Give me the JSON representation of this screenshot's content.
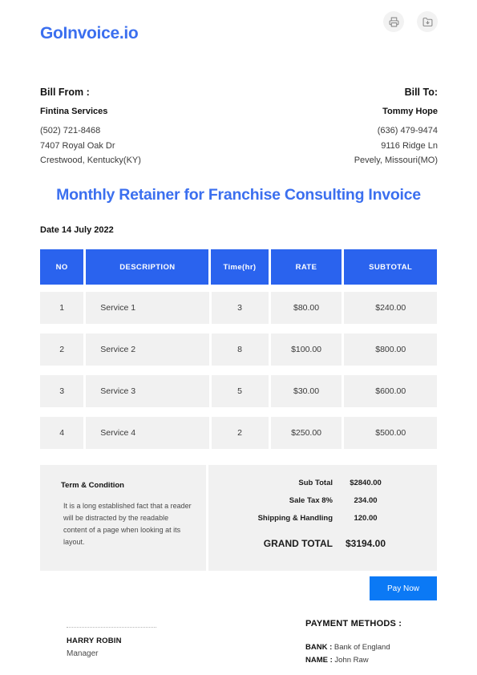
{
  "brand": {
    "logo_text": "GoInvoice.io",
    "accent_blue": "#3B6FEF",
    "table_header_blue": "#2A63EE",
    "pay_button_blue": "#0B79F5",
    "row_gray": "#f1f1f1"
  },
  "toolbar": {
    "print_icon": "printer-icon",
    "download_icon": "download-folder-icon"
  },
  "bill_from": {
    "heading": "Bill From :",
    "name": "Fintina Services",
    "phone": "(502) 721-8468",
    "address_line1": "7407 Royal Oak Dr",
    "address_line2": "Crestwood, Kentucky(KY)"
  },
  "bill_to": {
    "heading": "Bill To:",
    "name": "Tommy Hope",
    "phone": "(636) 479-9474",
    "address_line1": "9116 Ridge Ln",
    "address_line2": "Pevely, Missouri(MO)"
  },
  "invoice": {
    "title": "Monthly Retainer for Franchise Consulting Invoice",
    "date": "Date 14 July 2022"
  },
  "table": {
    "headers": {
      "no": "NO",
      "description": "DESCRIPTION",
      "time": "Time(hr)",
      "rate": "RATE",
      "subtotal": "SUBTOTAL"
    },
    "rows": [
      {
        "no": "1",
        "description": "Service 1",
        "time": "3",
        "rate": "$80.00",
        "subtotal": "$240.00"
      },
      {
        "no": "2",
        "description": "Service 2",
        "time": "8",
        "rate": "$100.00",
        "subtotal": "$800.00"
      },
      {
        "no": "3",
        "description": "Service 3",
        "time": "5",
        "rate": "$30.00",
        "subtotal": "$600.00"
      },
      {
        "no": "4",
        "description": "Service 4",
        "time": "2",
        "rate": "$250.00",
        "subtotal": "$500.00"
      }
    ]
  },
  "terms": {
    "title": "Term & Condition",
    "body": "It is a long established fact that a reader will be distracted by the readable content of a page when looking at its layout."
  },
  "totals": {
    "sub_total_label": "Sub Total",
    "sub_total_value": "$2840.00",
    "tax_label": "Sale Tax 8%",
    "tax_value": "234.00",
    "shipping_label": "Shipping & Handling",
    "shipping_value": "120.00",
    "grand_label": "GRAND TOTAL",
    "grand_value": "$3194.00"
  },
  "actions": {
    "pay_now": "Pay Now"
  },
  "signature": {
    "name": "HARRY ROBIN",
    "role": "Manager"
  },
  "payment_methods": {
    "title": "PAYMENT METHODS :",
    "bank_label": "BANK :",
    "bank_value": "Bank of England",
    "name_label": "NAME :",
    "name_value": "John Raw"
  }
}
